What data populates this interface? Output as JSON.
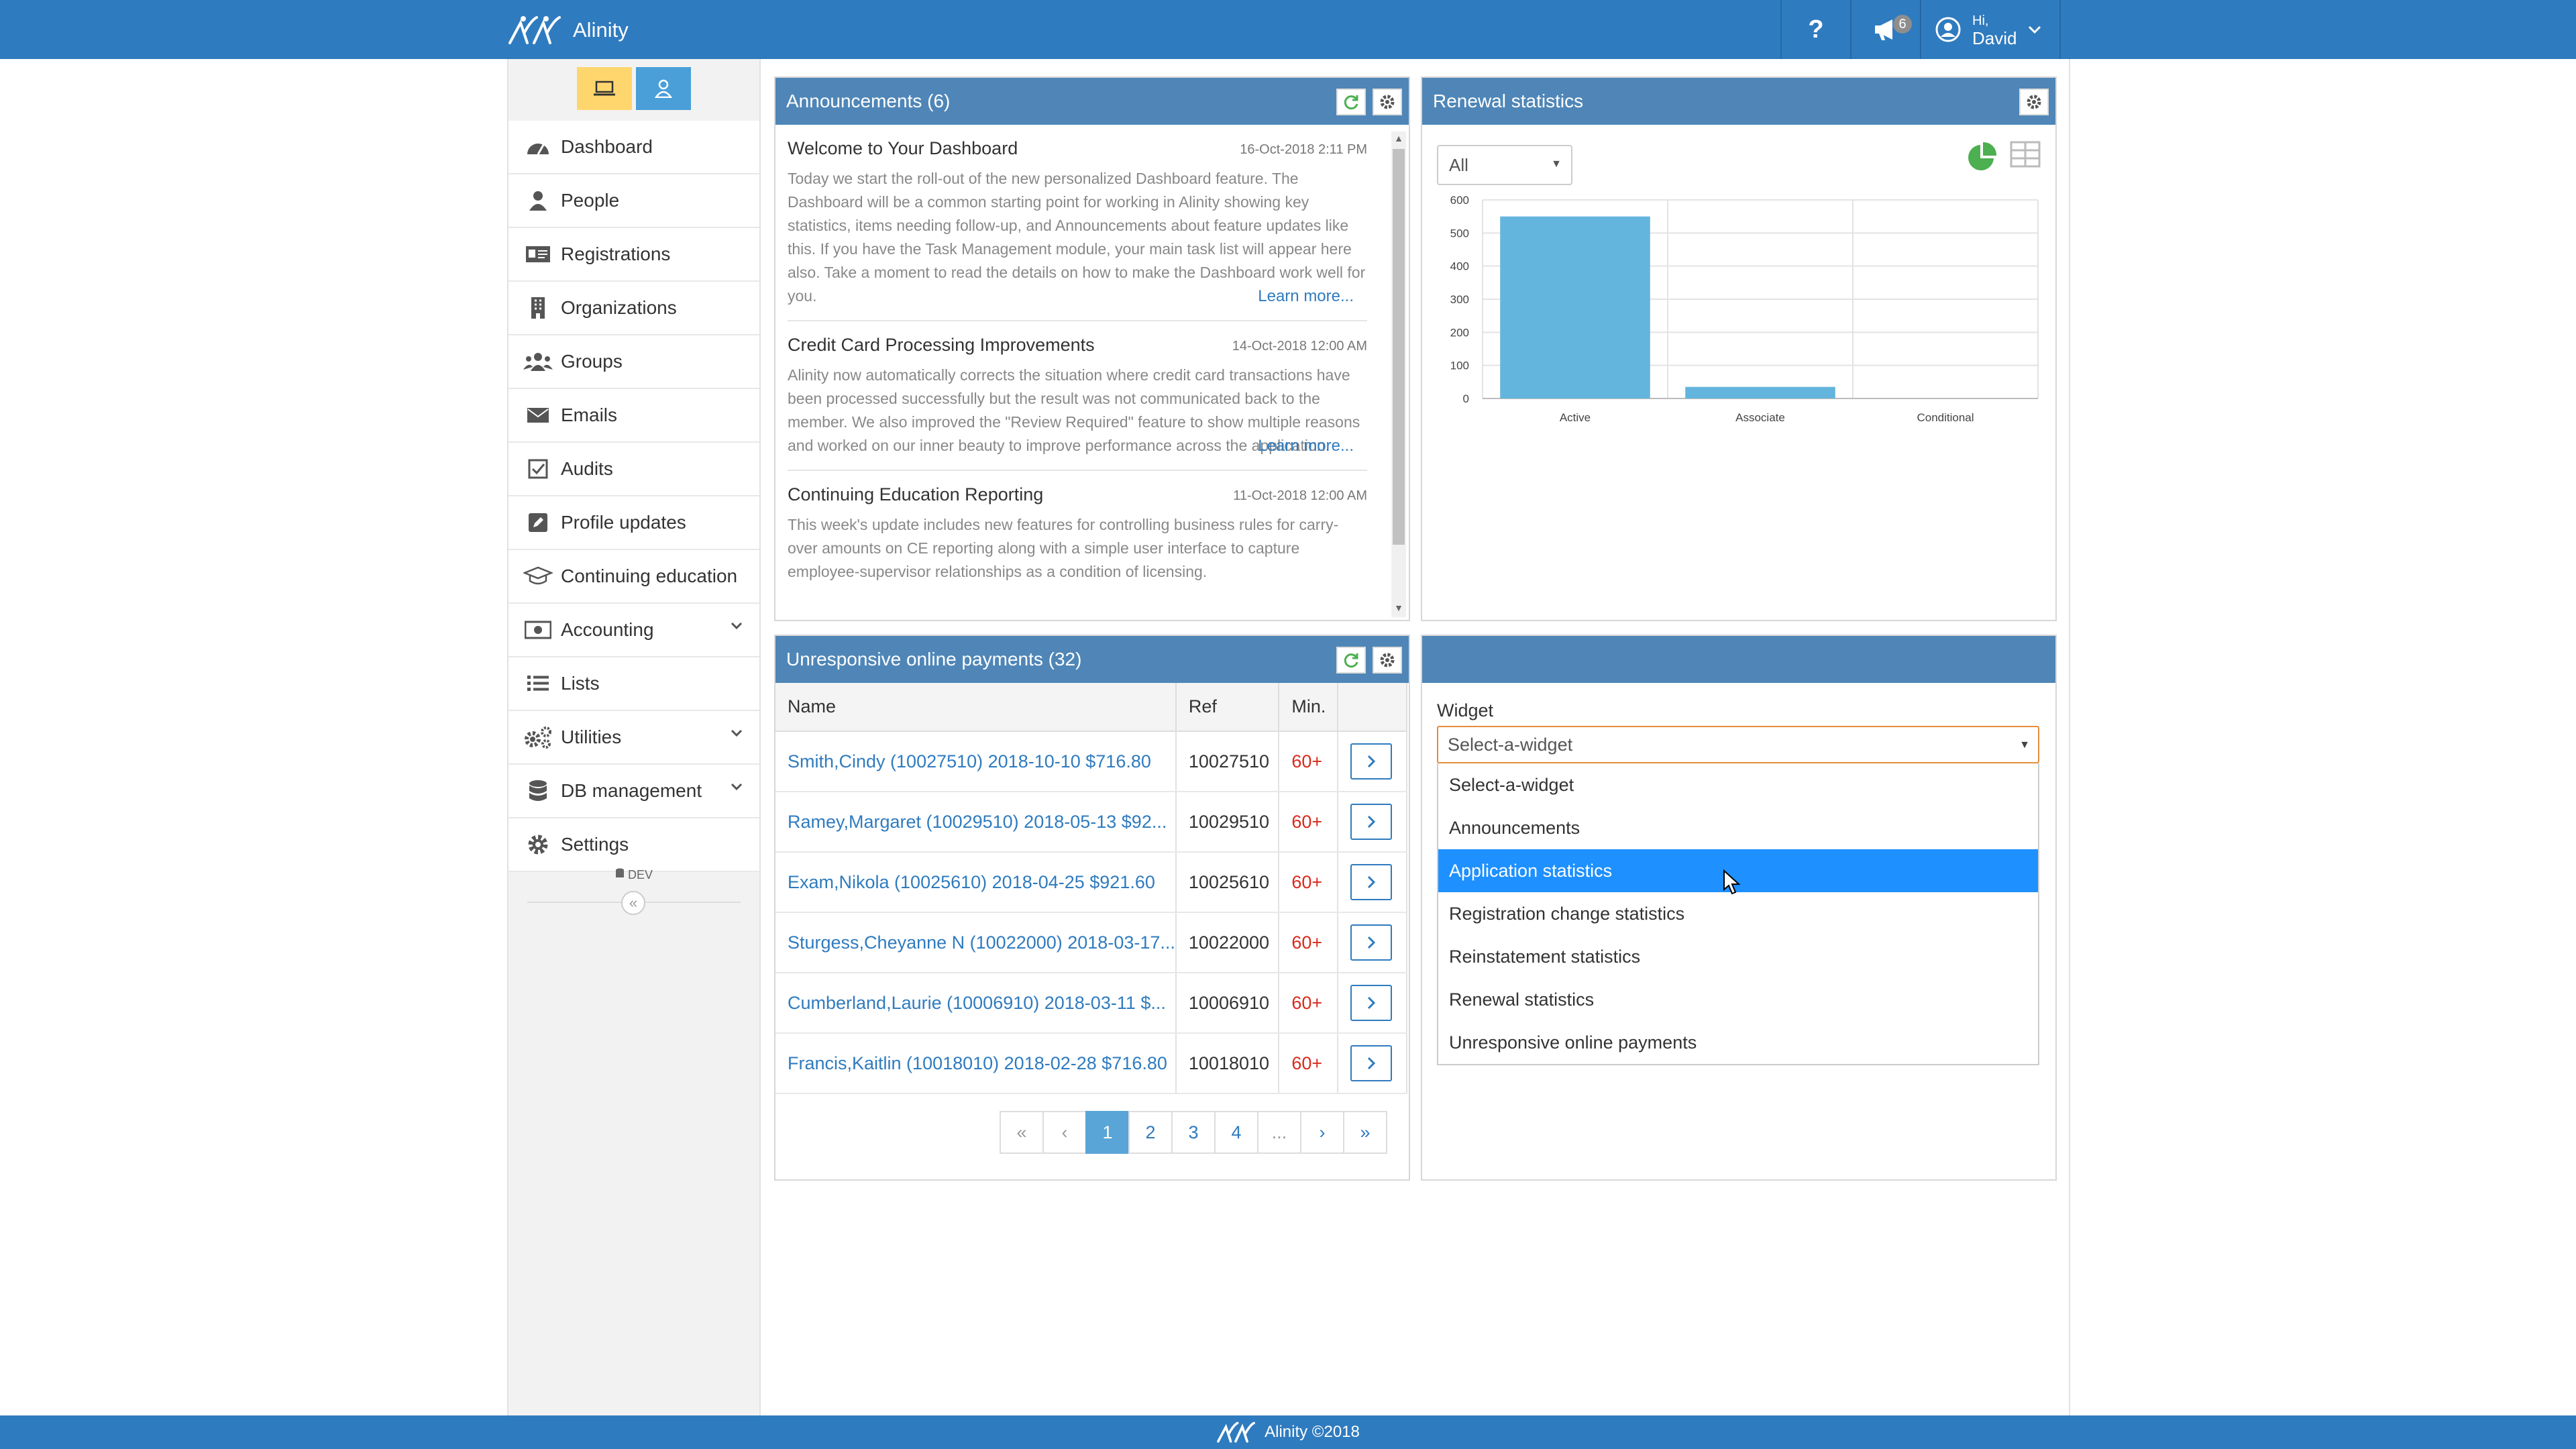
{
  "app": {
    "name": "Alinity"
  },
  "topbar": {
    "help_icon": "question-icon",
    "announcement_icon": "megaphone-icon",
    "announcement_count": "6",
    "user_greeting": "Hi,",
    "user_name": "David",
    "user_icon": "user-circle-icon"
  },
  "sidebar": {
    "mode_buttons": [
      {
        "icon": "laptop-icon"
      },
      {
        "icon": "person-icon"
      }
    ],
    "items": [
      {
        "label": "Dashboard",
        "icon": "dashboard-icon"
      },
      {
        "label": "People",
        "icon": "person-icon"
      },
      {
        "label": "Registrations",
        "icon": "id-card-icon"
      },
      {
        "label": "Organizations",
        "icon": "building-icon"
      },
      {
        "label": "Groups",
        "icon": "users-icon"
      },
      {
        "label": "Emails",
        "icon": "envelope-icon"
      },
      {
        "label": "Audits",
        "icon": "checkbox-icon"
      },
      {
        "label": "Profile updates",
        "icon": "edit-icon"
      },
      {
        "label": "Continuing education",
        "icon": "graduation-cap-icon"
      },
      {
        "label": "Accounting",
        "icon": "money-icon",
        "expandable": true
      },
      {
        "label": "Lists",
        "icon": "list-icon"
      },
      {
        "label": "Utilities",
        "icon": "cogs-icon",
        "expandable": true
      },
      {
        "label": "DB management",
        "icon": "database-icon",
        "expandable": true
      },
      {
        "label": "Settings",
        "icon": "gear-icon"
      }
    ],
    "environment": "DEV",
    "collapse_label": "«"
  },
  "announcements": {
    "title": "Announcements (6)",
    "items": [
      {
        "title": "Welcome to Your Dashboard",
        "date": "16-Oct-2018 2:11 PM",
        "body": "Today we start the roll-out of the new personalized Dashboard feature. The Dashboard will be a common starting point for working in Alinity showing key statistics, items needing follow-up, and Announcements about feature updates like this. If you have the Task Management module, your main task list will appear here also. Take a moment to read the details on how to make the Dashboard work well for you.",
        "link": "Learn more..."
      },
      {
        "title": "Credit Card Processing Improvements",
        "date": "14-Oct-2018 12:00 AM",
        "body": "Alinity now automatically corrects the situation where credit card transactions have been processed successfully but the result was not communicated back to the member. We also improved the \"Review Required\" feature to show multiple reasons and worked on our inner beauty to improve performance across the application.",
        "link": "Learn more..."
      },
      {
        "title": "Continuing Education Reporting",
        "date": "11-Oct-2018 12:00 AM",
        "body": "This week's update includes new features for controlling business rules for carry-over amounts on CE reporting along with a simple user interface to capture employee-supervisor relationships as a condition of licensing.",
        "link": ""
      }
    ]
  },
  "renewal": {
    "title": "Renewal statistics",
    "filter_value": "All",
    "chart_data": {
      "type": "bar",
      "categories": [
        "Active",
        "Associate",
        "Conditional"
      ],
      "values": [
        550,
        35,
        0
      ],
      "ylim": [
        0,
        600
      ],
      "yticks": [
        0,
        100,
        200,
        300,
        400,
        500,
        600
      ],
      "bar_color": "#64b5dd"
    }
  },
  "payments": {
    "title": "Unresponsive online payments (32)",
    "columns": [
      "Name",
      "Ref",
      "Min."
    ],
    "rows": [
      {
        "name": "Smith,Cindy (10027510) 2018-10-10 $716.80",
        "ref": "10027510",
        "min": "60+"
      },
      {
        "name": "Ramey,Margaret (10029510) 2018-05-13 $92...",
        "ref": "10029510",
        "min": "60+"
      },
      {
        "name": "Exam,Nikola (10025610) 2018-04-25 $921.60",
        "ref": "10025610",
        "min": "60+"
      },
      {
        "name": "Sturgess,Cheyanne N (10022000) 2018-03-17...",
        "ref": "10022000",
        "min": "60+"
      },
      {
        "name": "Cumberland,Laurie (10006910) 2018-03-11 $...",
        "ref": "10006910",
        "min": "60+"
      },
      {
        "name": "Francis,Kaitlin (10018010) 2018-02-28 $716.80",
        "ref": "10018010",
        "min": "60+"
      }
    ],
    "pager": {
      "first": "«",
      "prev": "‹",
      "pages": [
        "1",
        "2",
        "3",
        "4"
      ],
      "ellipsis": "...",
      "next": "›",
      "last": "»",
      "current": "1"
    }
  },
  "widget": {
    "label": "Widget",
    "selected": "Select-a-widget",
    "options": [
      "Select-a-widget",
      "Announcements",
      "Application statistics",
      "Registration change statistics",
      "Reinstatement statistics",
      "Renewal statistics",
      "Unresponsive online payments"
    ],
    "highlighted": "Application statistics"
  },
  "footer": {
    "text": "Alinity ©2018"
  },
  "colors": {
    "primary": "#2f7bbf",
    "panel_header": "#4f86b7",
    "warning": "#d9291c",
    "highlight": "#1e90ff"
  }
}
